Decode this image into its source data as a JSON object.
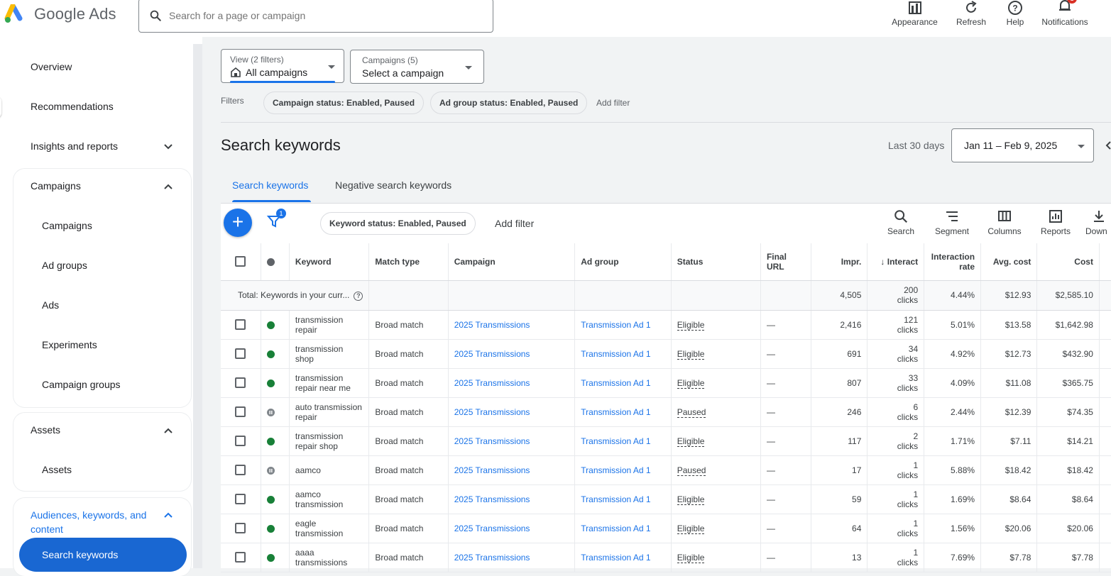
{
  "app": {
    "name": "Google Ads"
  },
  "search": {
    "placeholder": "Search for a page or campaign"
  },
  "toolbar": [
    {
      "label": "Appearance",
      "icon": "appearance-icon"
    },
    {
      "label": "Refresh",
      "icon": "refresh-icon"
    },
    {
      "label": "Help",
      "icon": "help-icon"
    },
    {
      "label": "Notifications",
      "icon": "bell-icon",
      "badge": "1"
    }
  ],
  "sidebar": {
    "top_items": [
      "Overview",
      "Recommendations",
      "Insights and reports"
    ],
    "campaigns": {
      "header": "Campaigns",
      "items": [
        "Campaigns",
        "Ad groups",
        "Ads",
        "Experiments",
        "Campaign groups"
      ]
    },
    "assets": {
      "header": "Assets",
      "items": [
        "Assets"
      ]
    },
    "audiences": {
      "header": "Audiences, keywords, and content",
      "active_item": "Search keywords"
    }
  },
  "view_dropdown": {
    "caption": "View (2 filters)",
    "value": "All campaigns"
  },
  "campaign_dropdown": {
    "caption": "Campaigns (5)",
    "value": "Select a campaign"
  },
  "filters": {
    "label": "Filters",
    "chips": [
      "Campaign status: Enabled, Paused",
      "Ad group status: Enabled, Paused"
    ],
    "add": "Add filter"
  },
  "page": {
    "title": "Search keywords"
  },
  "date": {
    "label": "Last 30 days",
    "range": "Jan 11 – Feb 9, 2025"
  },
  "tabs": [
    {
      "label": "Search keywords",
      "active": true
    },
    {
      "label": "Negative search keywords",
      "active": false
    }
  ],
  "table_toolbar": {
    "filter_badge": "1",
    "chip": "Keyword status: Enabled, Paused",
    "add_filter": "Add filter",
    "buttons": [
      "Search",
      "Segment",
      "Columns",
      "Reports",
      "Down"
    ]
  },
  "columns": [
    "Keyword",
    "Match type",
    "Campaign",
    "Ad group",
    "Status",
    "Final URL",
    "Impr.",
    "Interact",
    "Interaction rate",
    "Avg. cost",
    "Cost"
  ],
  "total_row": {
    "label": "Total: Keywords in your curr...",
    "impr": "4,505",
    "interactions": "200",
    "interactions_unit": "clicks",
    "rate": "4.44%",
    "avg_cost": "$12.93",
    "cost": "$2,585.10"
  },
  "rows": [
    {
      "keyword": "transmission repair",
      "match": "Broad match",
      "campaign": "2025 Transmissions",
      "ad_group": "Transmission Ad 1",
      "status": "Eligible",
      "status_color": "#188038",
      "final_url": "—",
      "impr": "2,416",
      "interactions": "121",
      "unit": "clicks",
      "rate": "5.01%",
      "avg_cost": "$13.58",
      "cost": "$1,642.98"
    },
    {
      "keyword": "transmission shop",
      "match": "Broad match",
      "campaign": "2025 Transmissions",
      "ad_group": "Transmission Ad 1",
      "status": "Eligible",
      "status_color": "#188038",
      "final_url": "—",
      "impr": "691",
      "interactions": "34",
      "unit": "clicks",
      "rate": "4.92%",
      "avg_cost": "$12.73",
      "cost": "$432.90"
    },
    {
      "keyword": "transmission repair near me",
      "match": "Broad match",
      "campaign": "2025 Transmissions",
      "ad_group": "Transmission Ad 1",
      "status": "Eligible",
      "status_color": "#188038",
      "final_url": "—",
      "impr": "807",
      "interactions": "33",
      "unit": "clicks",
      "rate": "4.09%",
      "avg_cost": "$11.08",
      "cost": "$365.75"
    },
    {
      "keyword": "auto transmission repair",
      "match": "Broad match",
      "campaign": "2025 Transmissions",
      "ad_group": "Transmission Ad 1",
      "status": "Paused",
      "status_color": "#80868b",
      "final_url": "—",
      "impr": "246",
      "interactions": "6",
      "unit": "clicks",
      "rate": "2.44%",
      "avg_cost": "$12.39",
      "cost": "$74.35"
    },
    {
      "keyword": "transmission repair shop",
      "match": "Broad match",
      "campaign": "2025 Transmissions",
      "ad_group": "Transmission Ad 1",
      "status": "Eligible",
      "status_color": "#188038",
      "final_url": "—",
      "impr": "117",
      "interactions": "2",
      "unit": "clicks",
      "rate": "1.71%",
      "avg_cost": "$7.11",
      "cost": "$14.21"
    },
    {
      "keyword": "aamco",
      "match": "Broad match",
      "campaign": "2025 Transmissions",
      "ad_group": "Transmission Ad 1",
      "status": "Paused",
      "status_color": "#80868b",
      "final_url": "—",
      "impr": "17",
      "interactions": "1",
      "unit": "clicks",
      "rate": "5.88%",
      "avg_cost": "$18.42",
      "cost": "$18.42"
    },
    {
      "keyword": "aamco transmission",
      "match": "Broad match",
      "campaign": "2025 Transmissions",
      "ad_group": "Transmission Ad 1",
      "status": "Eligible",
      "status_color": "#188038",
      "final_url": "—",
      "impr": "59",
      "interactions": "1",
      "unit": "clicks",
      "rate": "1.69%",
      "avg_cost": "$8.64",
      "cost": "$8.64"
    },
    {
      "keyword": "eagle transmission",
      "match": "Broad match",
      "campaign": "2025 Transmissions",
      "ad_group": "Transmission Ad 1",
      "status": "Eligible",
      "status_color": "#188038",
      "final_url": "—",
      "impr": "64",
      "interactions": "1",
      "unit": "clicks",
      "rate": "1.56%",
      "avg_cost": "$20.06",
      "cost": "$20.06"
    },
    {
      "keyword": "aaaa transmissions",
      "match": "Broad match",
      "campaign": "2025 Transmissions",
      "ad_group": "Transmission Ad 1",
      "status": "Eligible",
      "status_color": "#188038",
      "final_url": "—",
      "impr": "13",
      "interactions": "1",
      "unit": "clicks",
      "rate": "7.69%",
      "avg_cost": "$7.78",
      "cost": "$7.78"
    }
  ],
  "colors": {
    "accent": "#1a73e8",
    "active_nav": "#1967d2",
    "eligible": "#188038",
    "paused": "#80868b"
  }
}
